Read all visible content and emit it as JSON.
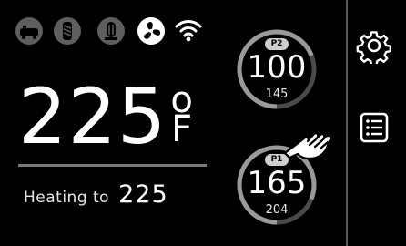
{
  "status_icons": [
    {
      "name": "grill-icon",
      "active": false
    },
    {
      "name": "auger-icon",
      "active": false
    },
    {
      "name": "igniter-icon",
      "active": false
    },
    {
      "name": "fan-icon",
      "active": true
    },
    {
      "name": "wifi-icon",
      "active": true
    }
  ],
  "main": {
    "temperature": "225",
    "degree_symbol": "o",
    "unit": "F",
    "heating_label": "Heating to",
    "target_temperature": "225"
  },
  "probes": {
    "p2": {
      "label": "P2",
      "current": "100",
      "target": "145",
      "progress": 0.69
    },
    "p1": {
      "label": "P1",
      "current": "165",
      "target": "204",
      "progress": 0.81
    }
  },
  "sidebar": {
    "settings_icon": "gear-icon",
    "menu_icon": "menu-list-icon"
  },
  "colors": {
    "background": "#000000",
    "active_icon": "#ffffff",
    "inactive_icon": "#5e5e5e",
    "gauge_track": "#4a4a4a",
    "gauge_fill": "#9a9a9a"
  }
}
